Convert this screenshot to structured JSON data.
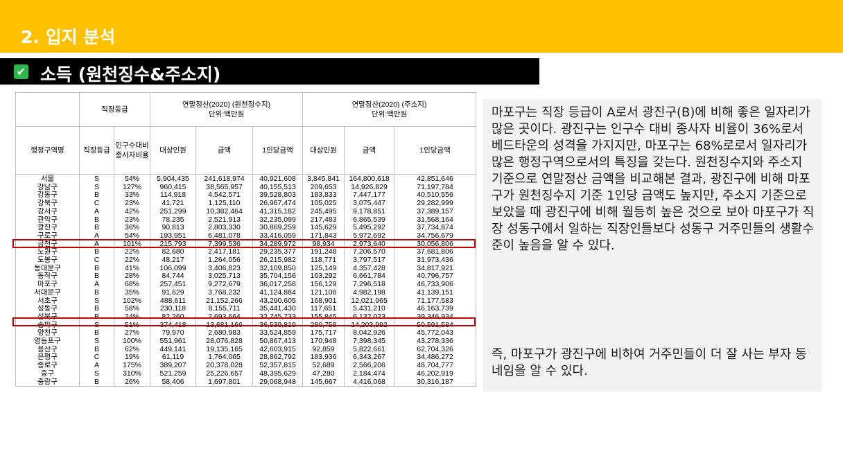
{
  "header": {
    "title": "2. 입지 분석"
  },
  "section": {
    "title": "소득 (원천징수&주소지)"
  },
  "table": {
    "group_headers": [
      "직장등급",
      "연말정산(2020) (원천징수지)\n단위:백만원",
      "연말정산(2020) (주소지)\n단위:백만원"
    ],
    "columns": [
      "행정구역명",
      "직장등급",
      "인구수대비\n종사자비율",
      "대상인원",
      "금액",
      "1인당금액",
      "대상인원",
      "금액",
      "1인당금액"
    ],
    "rows": [
      [
        "서울",
        "S",
        "54%",
        "5,904,435",
        "241,618,974",
        "40,921,608",
        "3,845,841",
        "164,800,618",
        "42,851,646"
      ],
      [
        "강남구",
        "S",
        "127%",
        "960,415",
        "38,565,957",
        "40,155,513",
        "209,653",
        "14,926,829",
        "71,197,784"
      ],
      [
        "강동구",
        "B",
        "33%",
        "114,918",
        "4,542,571",
        "39,528,803",
        "183,833",
        "7,447,177",
        "40,510,556"
      ],
      [
        "강북구",
        "C",
        "23%",
        "41,721",
        "1,125,110",
        "26,967,474",
        "105,025",
        "3,075,447",
        "29,282,999"
      ],
      [
        "강서구",
        "A",
        "42%",
        "251,299",
        "10,382,464",
        "41,315,182",
        "245,495",
        "9,178,851",
        "37,389,157"
      ],
      [
        "관악구",
        "B",
        "23%",
        "78,235",
        "2,521,913",
        "32,235,099",
        "217,483",
        "6,865,539",
        "31,568,164"
      ],
      [
        "광진구",
        "B",
        "36%",
        "90,813",
        "2,803,330",
        "30,869,259",
        "145,629",
        "5,495,292",
        "37,734,874"
      ],
      [
        "구로구",
        "A",
        "54%",
        "193,951",
        "6,481,078",
        "33,416,059",
        "171,843",
        "5,972,692",
        "34,756,679"
      ],
      [
        "금천구",
        "A",
        "101%",
        "215,793",
        "7,399,536",
        "34,289,972",
        "98,934",
        "2,973,640",
        "30,056,806"
      ],
      [
        "노원구",
        "B",
        "22%",
        "82,680",
        "2,417,181",
        "29,235,377",
        "191,248",
        "7,206,570",
        "37,681,806"
      ],
      [
        "도봉구",
        "C",
        "22%",
        "48,217",
        "1,264,056",
        "26,215,982",
        "118,771",
        "3,797,517",
        "31,973,436"
      ],
      [
        "동대문구",
        "B",
        "41%",
        "106,099",
        "3,406,823",
        "32,109,850",
        "125,149",
        "4,357,428",
        "34,817,921"
      ],
      [
        "동작구",
        "B",
        "28%",
        "84,744",
        "3,025,713",
        "35,704,156",
        "163,292",
        "6,661,784",
        "40,796,757"
      ],
      [
        "마포구",
        "A",
        "68%",
        "257,451",
        "9,272,679",
        "36,017,258",
        "156,129",
        "7,296,518",
        "46,733,906"
      ],
      [
        "서대문구",
        "B",
        "35%",
        "91,629",
        "3,768,232",
        "41,124,884",
        "121,106",
        "4,982,198",
        "41,139,151"
      ],
      [
        "서초구",
        "S",
        "102%",
        "488,611",
        "21,152,266",
        "43,290,605",
        "168,901",
        "12,021,965",
        "71,177,583"
      ],
      [
        "성동구",
        "B",
        "58%",
        "230,118",
        "8,155,711",
        "35,441,430",
        "117,651",
        "5,431,210",
        "46,163,739"
      ],
      [
        "성북구",
        "B",
        "24%",
        "82,260",
        "2,693,664",
        "32,745,733",
        "155,845",
        "6,132,023",
        "39,346,934"
      ],
      [
        "송파구",
        "S",
        "51%",
        "374,418",
        "13,681,166",
        "36,539,819",
        "280,758",
        "14,203,992",
        "50,591,584"
      ],
      [
        "양천구",
        "B",
        "27%",
        "79,970",
        "2,680,983",
        "33,524,859",
        "175,717",
        "8,042,926",
        "45,772,043"
      ],
      [
        "영등포구",
        "S",
        "100%",
        "551,961",
        "28,076,828",
        "50,867,413",
        "170,948",
        "7,398,345",
        "43,278,336"
      ],
      [
        "용산구",
        "B",
        "62%",
        "449,141",
        "19,135,165",
        "42,603,915",
        "92,859",
        "5,822,661",
        "62,704,326"
      ],
      [
        "은평구",
        "C",
        "19%",
        "61,119",
        "1,764,065",
        "28,862,792",
        "183,936",
        "6,343,267",
        "34,486,272"
      ],
      [
        "종로구",
        "A",
        "175%",
        "389,207",
        "20,378,028",
        "52,357,815",
        "52,689",
        "2,566,206",
        "48,704,777"
      ],
      [
        "중구",
        "S",
        "310%",
        "521,259",
        "25,226,657",
        "48,395,629",
        "47,280",
        "2,184,474",
        "46,202,919"
      ],
      [
        "중랑구",
        "B",
        "26%",
        "58,406",
        "1,697,801",
        "29,068,948",
        "145,667",
        "4,416,068",
        "30,316,187"
      ]
    ]
  },
  "analysis": {
    "paragraph1": "마포구는 직장 등급이 A로서 광진구(B)에 비해 좋은 일자리가 많은 곳이다. 광진구는 인구수 대비 종사자 비율이 36%로서 베드타운의 성격을 가지지만, 마포구는 68%로로서 일자리가 많은 행정구역으로서의 특징을 갖는다. 원천징수지와 주소지 기준으로 연말정산 금액을 비교해본 결과, 광진구에 비해 마포구가 원천징수지 기준 1인당 금액도 높지만, 주소지 기준으로 보았을 때 광진구에 비해 월등히 높은 것으로 보아 마포구가 직장 성동구에서 일하는 직장인들보다 성동구 거주민들의 생활수준이 높음을 알 수 있다.",
    "paragraph2": "즉, 마포구가 광진구에 비하여 거주민들이 더 잘 사는 부자 동네임을 알 수 있다."
  }
}
